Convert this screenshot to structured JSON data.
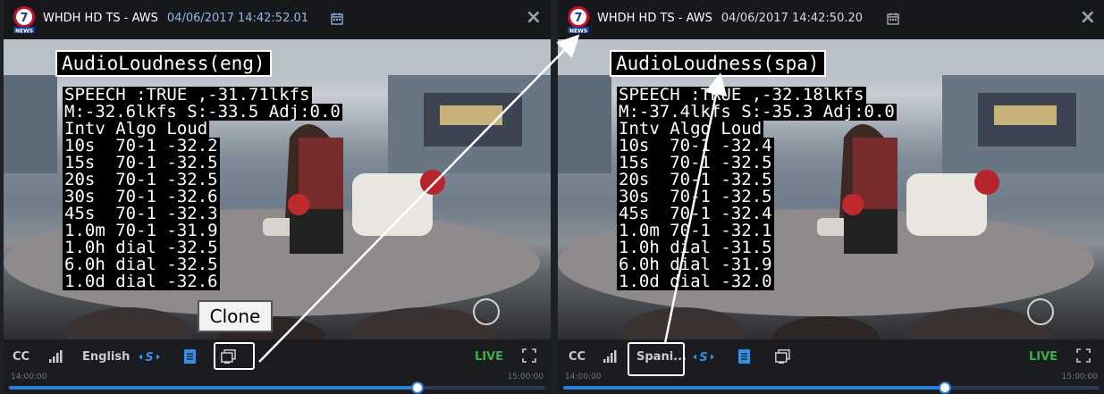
{
  "panels": [
    {
      "station": "WHDH HD TS - AWS",
      "timestamp": "04/06/2017 14:42:52.01",
      "osd_title": "AudioLoudness(eng)",
      "osd_lines": [
        "SPEECH :TRUE ,-31.71lkfs",
        "M:-32.6lkfs S:-33.5 Adj:0.0",
        "Intv Algo Loud",
        "10s  70-1 -32.2",
        "15s  70-1 -32.5",
        "20s  70-1 -32.5",
        "30s  70-1 -32.6",
        "45s  70-1 -32.3",
        "1.0m 70-1 -31.9",
        "1.0h dial -32.5",
        "6.0h dial -32.5",
        "1.0d dial -32.6"
      ],
      "controls": {
        "cc": "CC",
        "language": "English",
        "live": "LIVE",
        "time_start": "14:00:00",
        "time_end": "15:00:00"
      },
      "progress": 0.76
    },
    {
      "station": "WHDH HD TS - AWS",
      "timestamp": "04/06/2017 14:42:50.20",
      "osd_title": "AudioLoudness(spa)",
      "osd_lines": [
        "SPEECH :TRUE ,-32.18lkfs",
        "M:-37.4lkfs S:-35.3 Adj:0.0",
        "Intv Algo Loud",
        "10s  70-1 -32.4",
        "15s  70-1 -32.5",
        "20s  70-1 -32.5",
        "30s  70-1 -32.5",
        "45s  70-1 -32.4",
        "1.0m 70-1 -32.1",
        "1.0h dial -31.5",
        "6.0h dial -31.9",
        "1.0d dial -32.0"
      ],
      "controls": {
        "cc": "CC",
        "language": "Spani...",
        "live": "LIVE",
        "time_start": "14:00:00",
        "time_end": "15:00:00"
      },
      "progress": 0.71
    }
  ],
  "annotation": {
    "clone_label": "Clone"
  },
  "icons": [
    "news-logo-icon",
    "calendar-icon",
    "close-icon",
    "signal-bars-icon",
    "audio-track-icon",
    "note-icon",
    "clone-icon",
    "fullscreen-icon"
  ],
  "colors": {
    "accent": "#2a7fd4",
    "live": "#3fae4a",
    "timestamp": "#8fb9e3"
  }
}
